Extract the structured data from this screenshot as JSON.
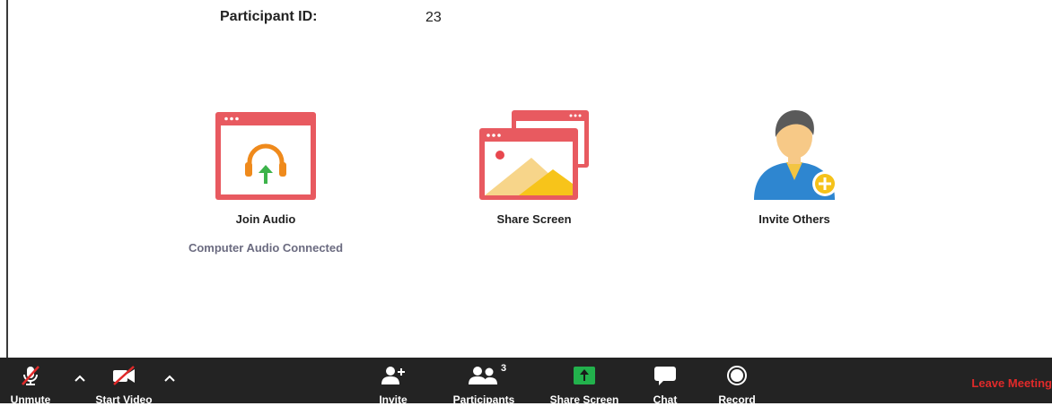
{
  "participant": {
    "label": "Participant ID:",
    "value": "23"
  },
  "actions": {
    "join_audio": {
      "label": "Join Audio",
      "status": "Computer Audio Connected"
    },
    "share_screen": {
      "label": "Share Screen"
    },
    "invite_others": {
      "label": "Invite Others"
    }
  },
  "toolbar": {
    "unmute": "Unmute",
    "start_video": "Start Video",
    "invite": "Invite",
    "participants": "Participants",
    "participants_count": "3",
    "share_screen": "Share Screen",
    "chat": "Chat",
    "record": "Record",
    "leave": "Leave Meeting"
  },
  "colors": {
    "toolbar_bg": "#232323",
    "icon_red": "#e85a60",
    "share_green": "#22b14c",
    "leave_red": "#e02a2a",
    "status_text": "#6b6b80"
  },
  "icons": [
    "microphone-muted-icon",
    "video-muted-icon",
    "caret-up-icon",
    "add-user-icon",
    "participants-icon",
    "share-screen-icon",
    "chat-icon",
    "record-icon",
    "headphones-icon",
    "image-window-icon",
    "user-plus-avatar-icon"
  ]
}
